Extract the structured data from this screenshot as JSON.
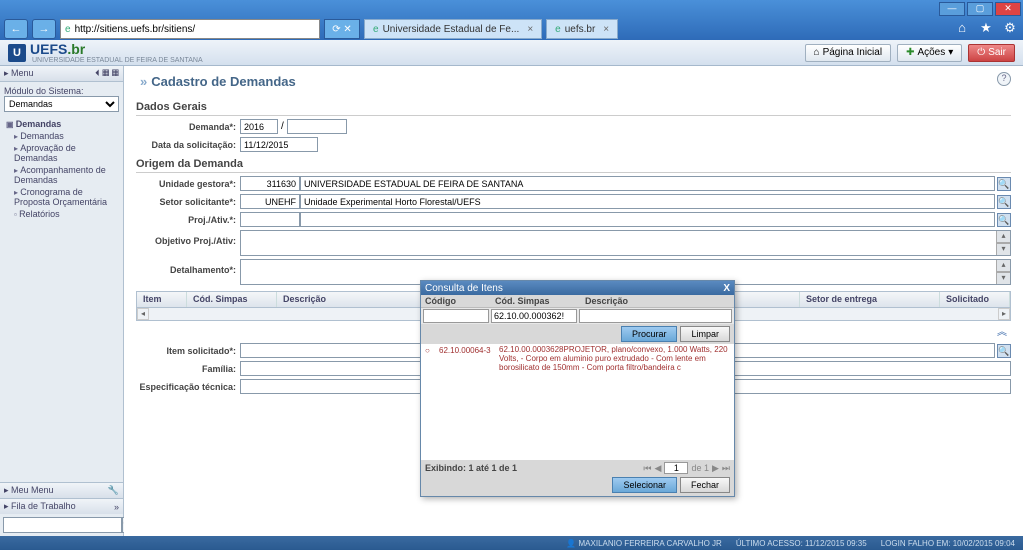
{
  "browser": {
    "url": "http://sitiens.uefs.br/sitiens/",
    "tabs": [
      {
        "label": "Universidade Estadual de Fe..."
      },
      {
        "label": "uefs.br"
      }
    ]
  },
  "logo": {
    "main": "UEFS",
    "suffix": ".br",
    "sub": "UNIVERSIDADE ESTADUAL DE FEIRA DE SANTANA"
  },
  "header": {
    "home": "Página Inicial",
    "actions": "Ações",
    "exit": "Sair"
  },
  "sidebar": {
    "menu_title": "Menu",
    "module_label": "Módulo do Sistema:",
    "module_value": "Demandas",
    "tree": {
      "root": "Demandas",
      "items": [
        "Demandas",
        "Aprovação de Demandas",
        "Acompanhamento de Demandas",
        "Cronograma de Proposta Orçamentária"
      ],
      "reports": "Relatórios"
    },
    "meu_menu": "Meu Menu",
    "fila": "Fila de Trabalho"
  },
  "page": {
    "title": "Cadastro de Demandas",
    "dados_gerais": "Dados Gerais",
    "demanda_label": "Demanda*:",
    "demanda_year": "2016",
    "demanda_sep": "/",
    "data_label": "Data da solicitação:",
    "data_value": "11/12/2015",
    "origem_title": "Origem da Demanda",
    "unidade_label": "Unidade gestora*:",
    "unidade_code": "311630",
    "unidade_name": "UNIVERSIDADE ESTADUAL DE FEIRA DE SANTANA",
    "setor_label": "Setor solicitante*:",
    "setor_code": "UNEHF",
    "setor_name": "Unidade Experimental Horto Florestal/UEFS",
    "proj_label": "Proj./Ativ.*:",
    "objetivo_label": "Objetivo Proj./Ativ:",
    "detalhamento_label": "Detalhamento*:",
    "grid": {
      "cols": [
        "Item",
        "Cód. Simpas",
        "Descrição",
        "Setor de entrega",
        "Solicitado"
      ]
    },
    "item_label": "Item solicitado*:",
    "familia_label": "Família:",
    "espec_label": "Especificação técnica:"
  },
  "modal": {
    "title": "Consulta de Itens",
    "close": "X",
    "cols": {
      "codigo": "Código",
      "simpas": "Cód. Simpas",
      "descricao": "Descrição"
    },
    "simpas_value": "62.10.00.000362!",
    "procurar": "Procurar",
    "limpar": "Limpar",
    "result": {
      "code": "62.10.00064-3",
      "simpas": "62.10.00.0003628",
      "desc": "PROJETOR, plano/convexo, 1.000 Watts, 220 Volts, - Corpo em aluminio puro extrudado - Com lente em borosilicato de 150mm - Com porta filtro/bandeira c"
    },
    "pager": {
      "info": "Exibindo: 1 até 1 de 1",
      "page": "1",
      "of": "de 1"
    },
    "selecionar": "Selecionar",
    "fechar": "Fechar"
  },
  "status": {
    "user": "MAXILANIO FERREIRA CARVALHO JR",
    "acesso": "ÚLTIMO ACESSO: 11/12/2015 09:35",
    "login": "LOGIN FALHO EM: 10/02/2015 09:04"
  }
}
